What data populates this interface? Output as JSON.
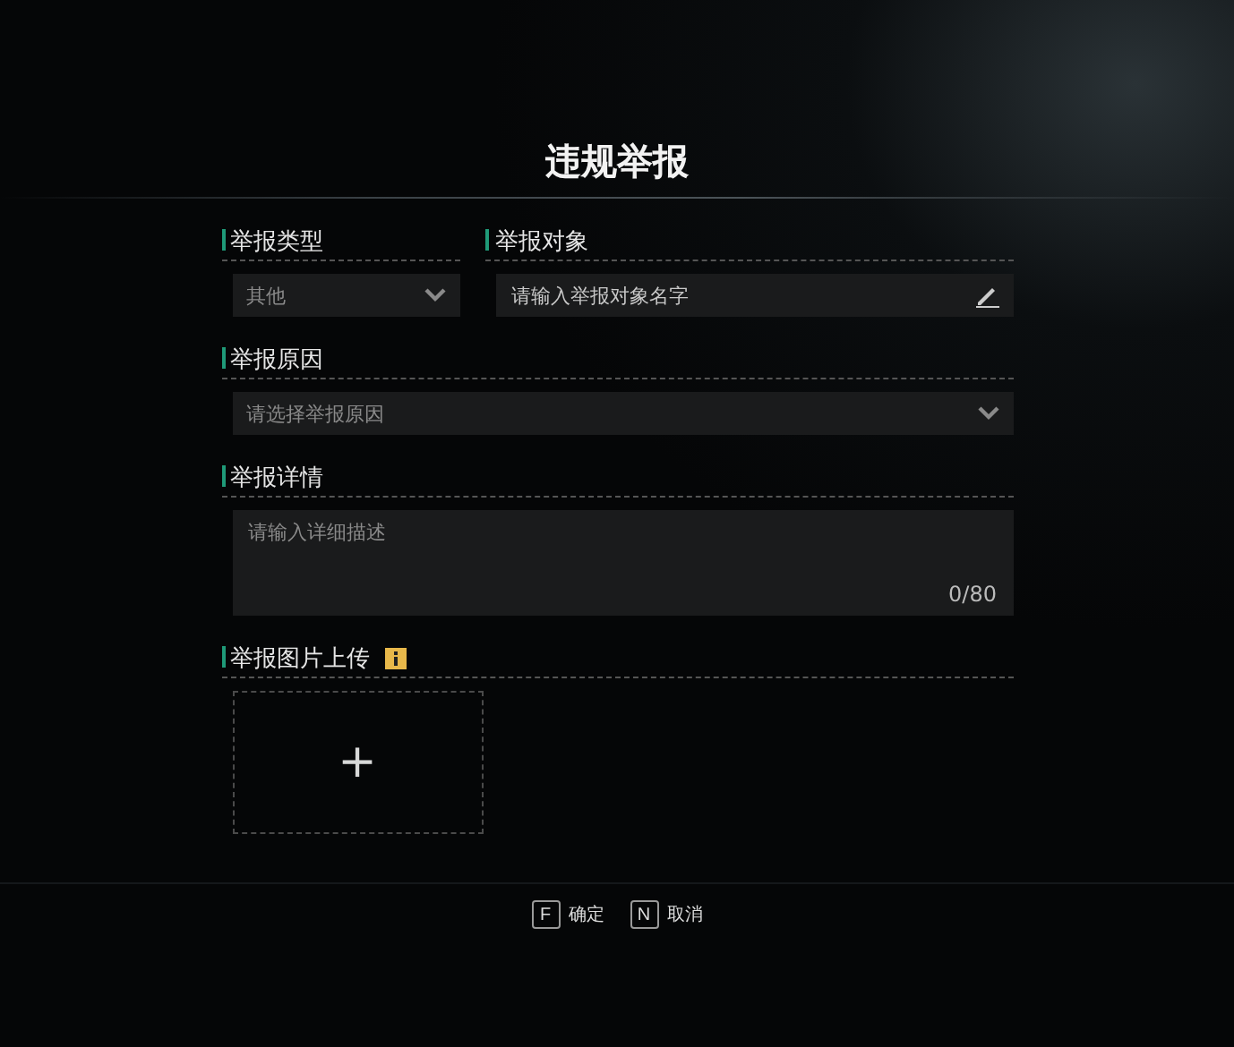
{
  "title": "违规举报",
  "report_type": {
    "label": "举报类型",
    "value": "其他"
  },
  "report_target": {
    "label": "举报对象",
    "placeholder": "请输入举报对象名字"
  },
  "report_reason": {
    "label": "举报原因",
    "placeholder": "请选择举报原因"
  },
  "report_details": {
    "label": "举报详情",
    "placeholder": "请输入详细描述",
    "counter": "0/80"
  },
  "image_upload": {
    "label": "举报图片上传",
    "plus": "+"
  },
  "actions": [
    {
      "key": "F",
      "label": "确定"
    },
    {
      "key": "N",
      "label": "取消"
    }
  ]
}
